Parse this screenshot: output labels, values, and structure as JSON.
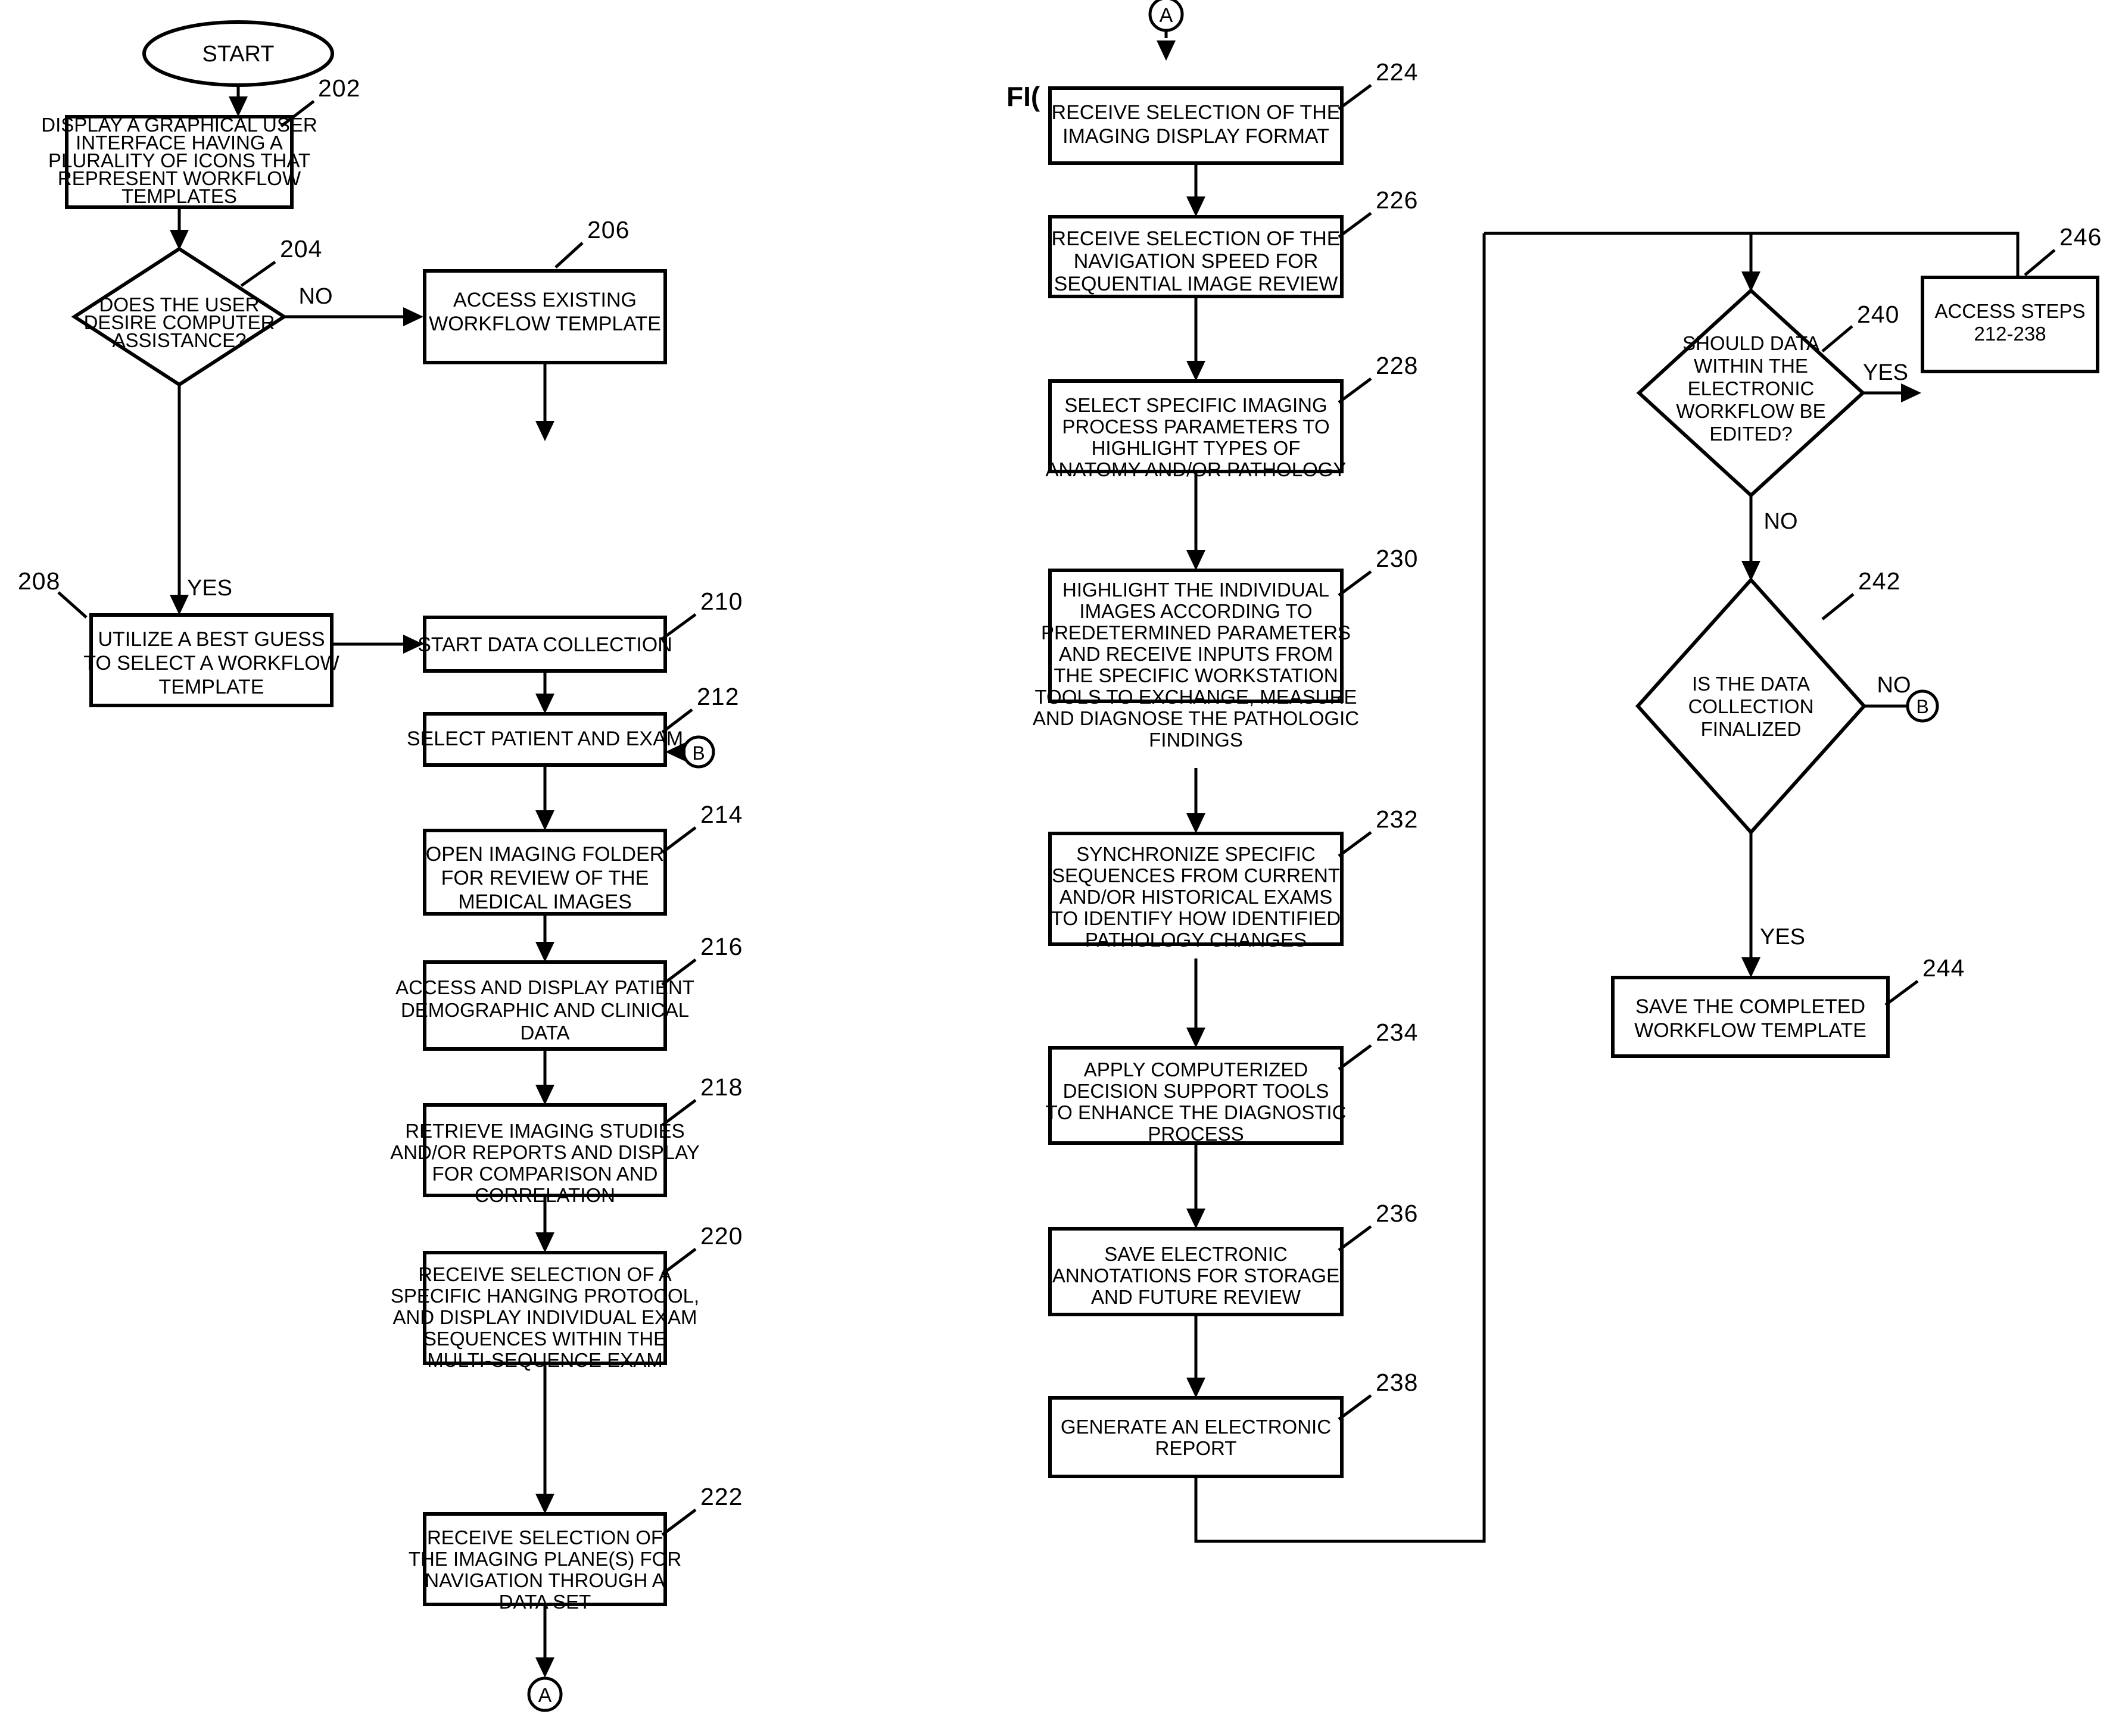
{
  "figure": {
    "label": "FI("
  },
  "terminals": {
    "start": "START",
    "connector_a_bottom": "A",
    "connector_a_top": "A",
    "connector_b_left": "B",
    "connector_b_right": "B"
  },
  "edge_labels": {
    "d204_no": "NO",
    "d204_yes": "YES",
    "d240_yes": "YES",
    "d240_no": "NO",
    "d242_no": "NO",
    "d242_yes": "YES"
  },
  "nodes": [
    {
      "ref": "202",
      "shape": "process",
      "lines": [
        "DISPLAY A GRAPHICAL USER",
        "INTERFACE HAVING A",
        "PLURALITY OF ICONS THAT",
        "REPRESENT WORKFLOW",
        "TEMPLATES"
      ]
    },
    {
      "ref": "204",
      "shape": "decision",
      "lines": [
        "DOES THE USER",
        "DESIRE COMPUTER",
        "ASSISTANCE?"
      ]
    },
    {
      "ref": "206",
      "shape": "process",
      "lines": [
        "ACCESS EXISTING",
        "WORKFLOW TEMPLATE"
      ]
    },
    {
      "ref": "208",
      "shape": "process",
      "lines": [
        "UTILIZE A BEST GUESS",
        "TO SELECT A WORKFLOW",
        "TEMPLATE"
      ]
    },
    {
      "ref": "210",
      "shape": "process",
      "lines": [
        "START DATA COLLECTION"
      ]
    },
    {
      "ref": "212",
      "shape": "process",
      "lines": [
        "SELECT PATIENT AND EXAM"
      ]
    },
    {
      "ref": "214",
      "shape": "process",
      "lines": [
        "OPEN IMAGING FOLDER",
        "FOR REVIEW OF THE",
        "MEDICAL IMAGES"
      ]
    },
    {
      "ref": "216",
      "shape": "process",
      "lines": [
        "ACCESS AND DISPLAY PATIENT",
        "DEMOGRAPHIC AND CLINICAL",
        "DATA"
      ]
    },
    {
      "ref": "218",
      "shape": "process",
      "lines": [
        "RETRIEVE IMAGING STUDIES",
        "AND/OR REPORTS AND DISPLAY",
        "FOR COMPARISON AND",
        "CORRELATION"
      ]
    },
    {
      "ref": "220",
      "shape": "process",
      "lines": [
        "RECEIVE SELECTION OF A",
        "SPECIFIC HANGING PROTOCOL,",
        "AND DISPLAY INDIVIDUAL EXAM",
        "SEQUENCES WITHIN THE",
        "MULTI-SEQUENCE EXAM"
      ]
    },
    {
      "ref": "222",
      "shape": "process",
      "lines": [
        "RECEIVE SELECTION OF",
        "THE IMAGING PLANE(S) FOR",
        "NAVIGATION THROUGH A",
        "DATA SET"
      ]
    },
    {
      "ref": "224",
      "shape": "process",
      "lines": [
        "RECEIVE SELECTION OF THE",
        "IMAGING DISPLAY FORMAT"
      ]
    },
    {
      "ref": "226",
      "shape": "process",
      "lines": [
        "RECEIVE SELECTION OF THE",
        "NAVIGATION SPEED FOR",
        "SEQUENTIAL IMAGE REVIEW"
      ]
    },
    {
      "ref": "228",
      "shape": "process",
      "lines": [
        "SELECT SPECIFIC IMAGING",
        "PROCESS PARAMETERS TO",
        "HIGHLIGHT TYPES OF",
        "ANATOMY AND/OR PATHOLOGY"
      ]
    },
    {
      "ref": "230",
      "shape": "process",
      "lines": [
        "HIGHLIGHT THE INDIVIDUAL",
        "IMAGES ACCORDING TO",
        "PREDETERMINED PARAMETERS",
        "AND RECEIVE  INPUTS FROM",
        "THE SPECIFIC  WORKSTATION",
        "TOOLS TO EXCHANGE, MEASURE",
        "AND DIAGNOSE THE PATHOLOGIC",
        "FINDINGS"
      ]
    },
    {
      "ref": "232",
      "shape": "process",
      "lines": [
        "SYNCHRONIZE SPECIFIC",
        "SEQUENCES FROM CURRENT",
        "AND/OR HISTORICAL EXAMS",
        "TO IDENTIFY HOW IDENTIFIED",
        "PATHOLOGY CHANGES"
      ]
    },
    {
      "ref": "234",
      "shape": "process",
      "lines": [
        "APPLY COMPUTERIZED",
        "DECISION SUPPORT TOOLS",
        "TO ENHANCE THE DIAGNOSTIC",
        "PROCESS"
      ]
    },
    {
      "ref": "236",
      "shape": "process",
      "lines": [
        "SAVE ELECTRONIC",
        "ANNOTATIONS FOR STORAGE",
        "AND FUTURE REVIEW"
      ]
    },
    {
      "ref": "238",
      "shape": "process",
      "lines": [
        "GENERATE AN ELECTRONIC",
        "REPORT"
      ]
    },
    {
      "ref": "240",
      "shape": "decision",
      "lines": [
        "SHOULD DATA",
        "WITHIN THE",
        "ELECTRONIC",
        "WORKFLOW BE",
        "EDITED?"
      ]
    },
    {
      "ref": "242",
      "shape": "decision",
      "lines": [
        "IS THE DATA",
        "COLLECTION",
        "FINALIZED"
      ]
    },
    {
      "ref": "244",
      "shape": "process",
      "lines": [
        "SAVE THE COMPLETED",
        "WORKFLOW TEMPLATE"
      ]
    },
    {
      "ref": "246",
      "shape": "process",
      "lines": [
        "ACCESS STEPS",
        "212-238"
      ]
    }
  ],
  "colors": {
    "ink": "#000000",
    "paper": "#ffffff"
  }
}
